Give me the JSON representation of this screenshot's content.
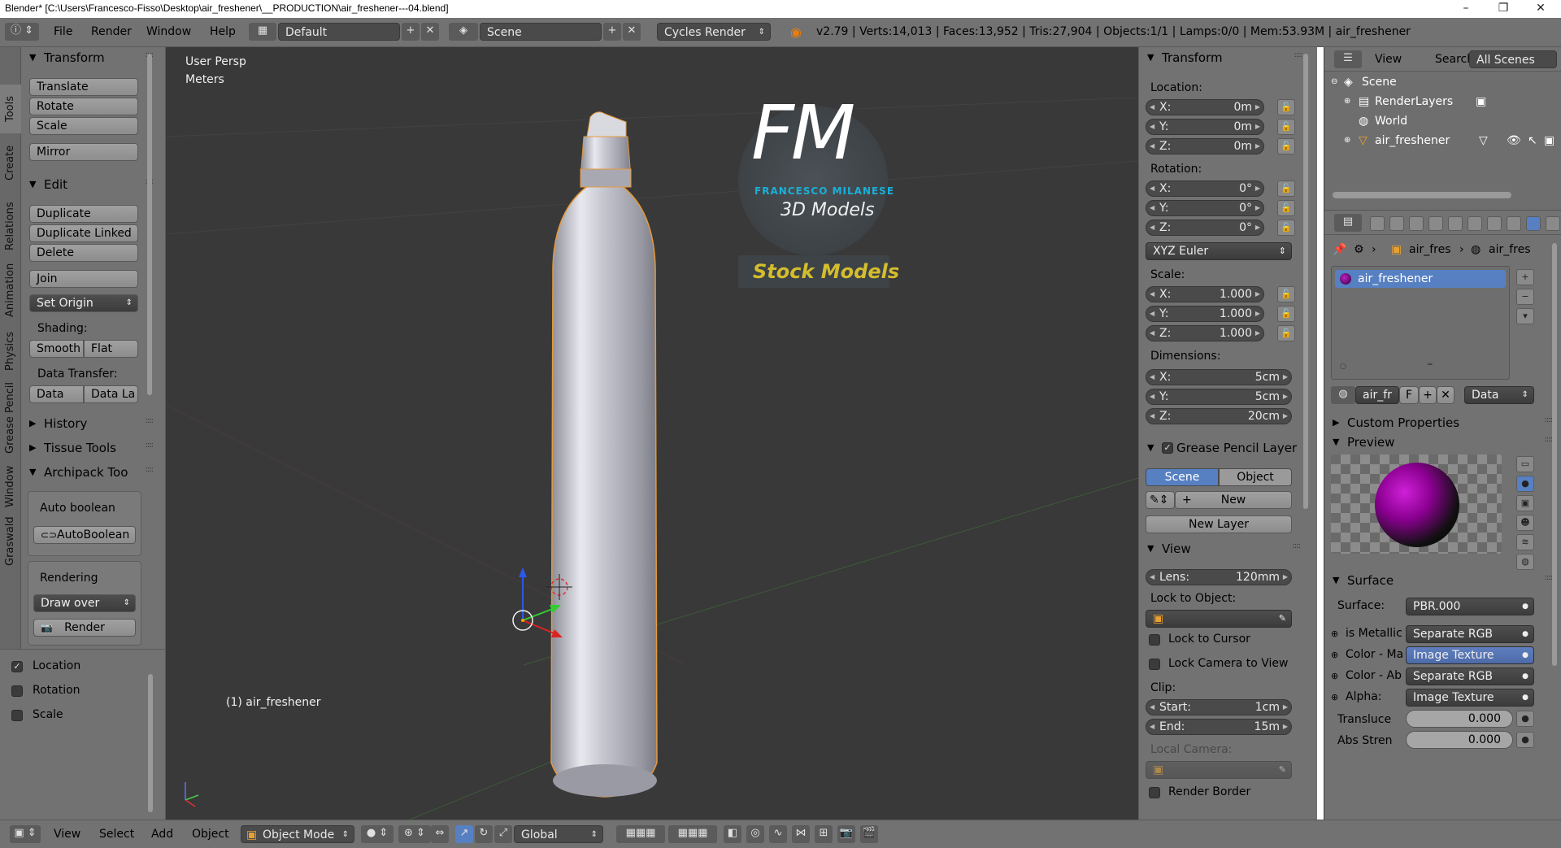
{
  "window": {
    "title": "Blender* [C:\\Users\\Francesco-Fisso\\Desktop\\air_freshener\\__PRODUCTION\\air_freshener---04.blend]",
    "minimize": "–",
    "maximize": "❐",
    "close": "✕"
  },
  "top_header": {
    "menus": [
      "File",
      "Render",
      "Window",
      "Help"
    ],
    "layout": "Default",
    "scene": "Scene",
    "engine": "Cycles Render",
    "stats": "v2.79 | Verts:14,013 | Faces:13,952 | Tris:27,904 | Objects:1/1 | Lamps:0/0 | Mem:53.93M | air_freshener"
  },
  "left_tabs": [
    "Tools",
    "Create",
    "Relations",
    "Animation",
    "Physics",
    "Grease Pencil",
    "Window",
    "Graswald"
  ],
  "tool_shelf": {
    "transform": {
      "title": "Transform",
      "buttons": [
        "Translate",
        "Rotate",
        "Scale",
        "Mirror"
      ]
    },
    "edit": {
      "title": "Edit",
      "buttons": [
        "Duplicate",
        "Duplicate Linked",
        "Delete",
        "Join"
      ],
      "set_origin": "Set Origin",
      "shading_label": "Shading:",
      "smooth": "Smooth",
      "flat": "Flat",
      "data_transfer_label": "Data Transfer:",
      "data": "Data",
      "data_layout": "Data La"
    },
    "history": "History",
    "tissue": "Tissue Tools",
    "archipack": {
      "title": "Archipack Too",
      "auto_boolean_label": "Auto boolean",
      "auto_boolean_btn": "AutoBoolean",
      "rendering_label": "Rendering",
      "draw_over": "Draw over",
      "render": "Render"
    }
  },
  "operator_panel": {
    "location": "Location",
    "rotation": "Rotation",
    "scale": "Scale"
  },
  "viewport": {
    "view_name": "User Persp",
    "units": "Meters",
    "object_label": "(1) air_freshener",
    "logo": {
      "letters": "FM",
      "name": "FRANCESCO MILANESE",
      "sub": "3D Models",
      "tag": "Stock Models"
    }
  },
  "n_panel": {
    "transform_title": "Transform",
    "location_label": "Location:",
    "location": [
      {
        "k": "X:",
        "v": "0m"
      },
      {
        "k": "Y:",
        "v": "0m"
      },
      {
        "k": "Z:",
        "v": "0m"
      }
    ],
    "rotation_label": "Rotation:",
    "rotation": [
      {
        "k": "X:",
        "v": "0°"
      },
      {
        "k": "Y:",
        "v": "0°"
      },
      {
        "k": "Z:",
        "v": "0°"
      }
    ],
    "rotation_mode": "XYZ Euler",
    "scale_label": "Scale:",
    "scale": [
      {
        "k": "X:",
        "v": "1.000"
      },
      {
        "k": "Y:",
        "v": "1.000"
      },
      {
        "k": "Z:",
        "v": "1.000"
      }
    ],
    "dimensions_label": "Dimensions:",
    "dimensions": [
      {
        "k": "X:",
        "v": "5cm"
      },
      {
        "k": "Y:",
        "v": "5cm"
      },
      {
        "k": "Z:",
        "v": "20cm"
      }
    ],
    "grease_title": "Grease Pencil Layer",
    "scene_btn": "Scene",
    "object_btn": "Object",
    "new_btn": "New",
    "new_layer_btn": "New Layer",
    "view_title": "View",
    "lens_label": "Lens:",
    "lens_value": "120mm",
    "lock_to_object_label": "Lock to Object:",
    "lock_to_cursor": "Lock to Cursor",
    "lock_camera": "Lock Camera to View",
    "clip_label": "Clip:",
    "clip_start_label": "Start:",
    "clip_start": "1cm",
    "clip_end_label": "End:",
    "clip_end": "15m",
    "local_camera_label": "Local Camera:",
    "render_border": "Render Border"
  },
  "outliner": {
    "view": "View",
    "search": "Search",
    "filter": "All Scenes",
    "rows": [
      "Scene",
      "RenderLayers",
      "World",
      "air_freshener"
    ]
  },
  "properties": {
    "breadcrumb_1": "air_fres",
    "breadcrumb_2": "air_fres",
    "material_slot": "air_freshener",
    "material_name": "air_fr",
    "fake_user": "F",
    "data_mode": "Data",
    "custom_props": "Custom Properties",
    "preview": "Preview",
    "surface_title": "Surface",
    "surface_label": "Surface:",
    "surface_value": "PBR.000",
    "inputs": [
      {
        "label": "is Metallic",
        "value": "Separate RGB"
      },
      {
        "label": "Color - Ma",
        "value": "Image Texture"
      },
      {
        "label": "Color - Ab",
        "value": "Separate RGB"
      },
      {
        "label": "Alpha:",
        "value": "Image Texture"
      }
    ],
    "translucency_label": "Transluce",
    "translucency_value": "0.000",
    "abs_label": "Abs Stren",
    "abs_value": "0.000"
  },
  "bottom_bar": {
    "menus": [
      "View",
      "Select",
      "Add",
      "Object"
    ],
    "mode": "Object Mode",
    "orientation": "Global"
  },
  "colors": {
    "header_bg": "#727272",
    "viewport_bg": "#393939",
    "selection_blue": "#5680c2",
    "logo_teal": "#1ab0d8",
    "logo_gold": "#d4bd2e"
  }
}
